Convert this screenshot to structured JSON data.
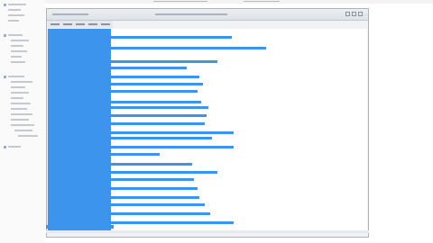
{
  "app": {
    "title": ""
  },
  "menus": [
    "",
    "",
    "",
    "",
    ""
  ],
  "rows": [
    "",
    "",
    "",
    "",
    "",
    "",
    "",
    "",
    "",
    "",
    "",
    "",
    "",
    "",
    "",
    "",
    "",
    "",
    "",
    "",
    "",
    "",
    ""
  ],
  "colors": {
    "accent": "#3d94ec",
    "window_bg": "#f0f2f5",
    "border": "#b0b4ba"
  }
}
